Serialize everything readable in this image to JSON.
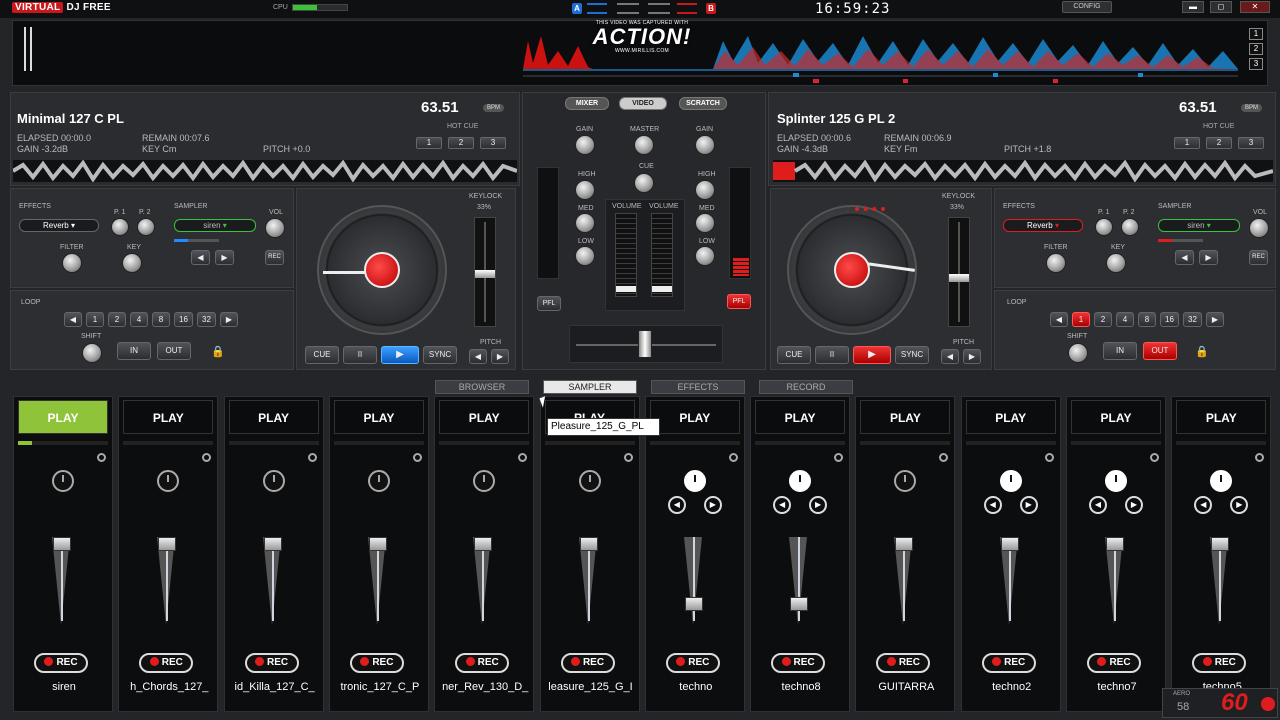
{
  "app": {
    "logo_a": "VIRTUAL",
    "logo_b": "DJ FREE",
    "cpu_label": "CPU",
    "cpu_level": 0.45,
    "clock": "16:59:23",
    "config": "CONFIG",
    "abtn": "A",
    "bbtn": "B"
  },
  "window": {
    "min": "▬",
    "max": "◻",
    "close": "✕"
  },
  "overlay": {
    "captured": "THIS VIDEO WAS CAPTURED WITH",
    "brand": "ACTION!",
    "url": "WWW.MIRILLIS.COM"
  },
  "overview": {
    "buttons": [
      "1",
      "2",
      "3"
    ]
  },
  "deck_left": {
    "title": "Minimal 127 C PL",
    "bpm": "63.51",
    "bpm_label": "BPM",
    "elapsed": "ELAPSED 00:00.0",
    "remain": "REMAIN 00:07.6",
    "gain": "GAIN -3.2dB",
    "key": "KEY Cm",
    "pitch": "PITCH +0.0",
    "hotcue_label": "HOT CUE",
    "hotcues": [
      "1",
      "2",
      "3"
    ]
  },
  "deck_right": {
    "title": "Splinter 125 G PL 2",
    "bpm": "63.51",
    "bpm_label": "BPM",
    "elapsed": "ELAPSED 00:00.6",
    "remain": "REMAIN 00:06.9",
    "gain": "GAIN -4.3dB",
    "key": "KEY Fm",
    "pitch": "PITCH +1.8",
    "hotcue_label": "HOT CUE",
    "hotcues": [
      "1",
      "2",
      "3"
    ]
  },
  "effects": {
    "label": "EFFECTS",
    "effect": "Reverb",
    "p1": "P. 1",
    "p2": "P. 2",
    "filter": "FILTER",
    "key": "KEY",
    "sampler": "SAMPLER",
    "sample": "siren",
    "vol": "VOL",
    "rec": "REC"
  },
  "loop": {
    "label": "LOOP",
    "sizes": [
      "1",
      "2",
      "4",
      "8",
      "16",
      "32"
    ],
    "shift": "SHIFT",
    "in": "IN",
    "out": "OUT"
  },
  "transport": {
    "cue": "CUE",
    "pause": "II",
    "play": "▶",
    "sync": "SYNC",
    "keylock": "KEYLOCK",
    "keylock_val": "33%",
    "pitch": "PITCH"
  },
  "mixer": {
    "tabs": [
      "MIXER",
      "VIDEO",
      "SCRATCH"
    ],
    "gain": "GAIN",
    "master": "MASTER",
    "cue": "CUE",
    "high": "HIGH",
    "med": "MED",
    "low": "LOW",
    "volume": "VOLUME",
    "pfl": "PFL"
  },
  "tabs": [
    "BROWSER",
    "SAMPLER",
    "EFFECTS",
    "RECORD"
  ],
  "tooltip": "Pleasure_125_G_PL",
  "sampler": {
    "play_label": "PLAY",
    "rec_label": "REC",
    "slots": [
      {
        "name": "siren",
        "active": true,
        "progress": 0.15,
        "mode": "single",
        "fader": 0.0
      },
      {
        "name": "h_Chords_127_",
        "active": false,
        "progress": 0,
        "mode": "single",
        "fader": 0.0
      },
      {
        "name": "id_Killa_127_C_",
        "active": false,
        "progress": 0,
        "mode": "single",
        "fader": 0.0
      },
      {
        "name": "tronic_127_C_P",
        "active": false,
        "progress": 0,
        "mode": "single",
        "fader": 0.0
      },
      {
        "name": "ner_Rev_130_D_",
        "active": false,
        "progress": 0,
        "mode": "single",
        "fader": 0.0
      },
      {
        "name": "leasure_125_G_I",
        "active": false,
        "progress": 0,
        "mode": "single",
        "fader": 0.0
      },
      {
        "name": "techno",
        "active": false,
        "progress": 0,
        "mode": "triple",
        "fader": 0.85
      },
      {
        "name": "techno8",
        "active": false,
        "progress": 0,
        "mode": "triple",
        "fader": 0.85
      },
      {
        "name": "GUITARRA",
        "active": false,
        "progress": 0,
        "mode": "single",
        "fader": 0.0
      },
      {
        "name": "techno2",
        "active": false,
        "progress": 0,
        "mode": "triple",
        "fader": 0.0
      },
      {
        "name": "techno7",
        "active": false,
        "progress": 0,
        "mode": "triple",
        "fader": 0.0
      },
      {
        "name": "techno5",
        "active": false,
        "progress": 0,
        "mode": "triple",
        "fader": 0.0
      }
    ]
  },
  "fps": {
    "label": "AERO",
    "value_small": "58",
    "value_big": "60"
  },
  "colors": {
    "accent_red": "#e01d1d",
    "accent_green": "#8fc43a",
    "accent_blue": "#2a8cff"
  }
}
